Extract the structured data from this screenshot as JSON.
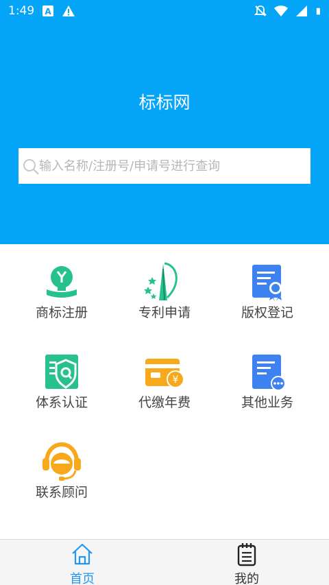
{
  "status_bar": {
    "time": "1:49",
    "icons": [
      "notification-a-icon",
      "warning-icon",
      "mute-icon",
      "wifi-icon",
      "signal-icon",
      "battery-icon"
    ]
  },
  "header": {
    "title": "标标网",
    "background_color": "#04a4f7"
  },
  "search": {
    "placeholder": "输入名称/注册号/申请号进行查询",
    "value": ""
  },
  "services": [
    {
      "label": "商标注册",
      "icon": "trademark-icon"
    },
    {
      "label": "专利申请",
      "icon": "patent-icon"
    },
    {
      "label": "版权登记",
      "icon": "copyright-icon"
    },
    {
      "label": "体系认证",
      "icon": "certification-icon"
    },
    {
      "label": "代缴年费",
      "icon": "annual-fee-icon"
    },
    {
      "label": "其他业务",
      "icon": "other-business-icon"
    },
    {
      "label": "联系顾问",
      "icon": "consultant-icon"
    }
  ],
  "tabbar": {
    "tabs": [
      {
        "label": "首页",
        "icon": "home-icon",
        "active": true
      },
      {
        "label": "我的",
        "icon": "profile-notebook-icon",
        "active": false
      }
    ],
    "active_color": "#2196f3",
    "inactive_color": "#333333"
  }
}
